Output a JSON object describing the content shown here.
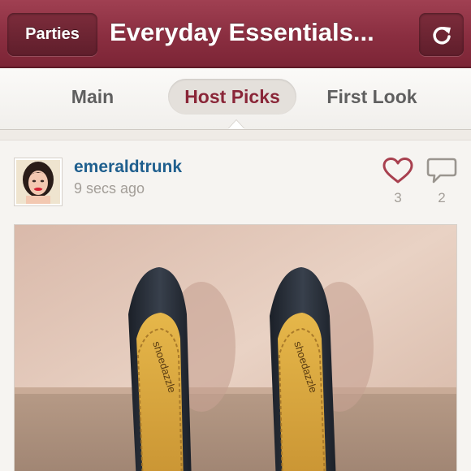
{
  "header": {
    "back_label": "Parties",
    "title": "Everyday Essentials...",
    "refresh_icon": "refresh-icon"
  },
  "tabs": [
    {
      "label": "Main",
      "active": false
    },
    {
      "label": "Host Picks",
      "active": true
    },
    {
      "label": "First Look",
      "active": false
    }
  ],
  "post": {
    "username": "emeraldtrunk",
    "time": "9 secs ago",
    "likes": "3",
    "comments": "2",
    "like_icon": "heart-icon",
    "comment_icon": "speech-bubble-icon",
    "insole_brand": "shoedazzle"
  },
  "colors": {
    "header": "#8a2e40",
    "active_tab_text": "#8a2638",
    "username": "#1f5f8e",
    "heart": "#a8404f"
  }
}
